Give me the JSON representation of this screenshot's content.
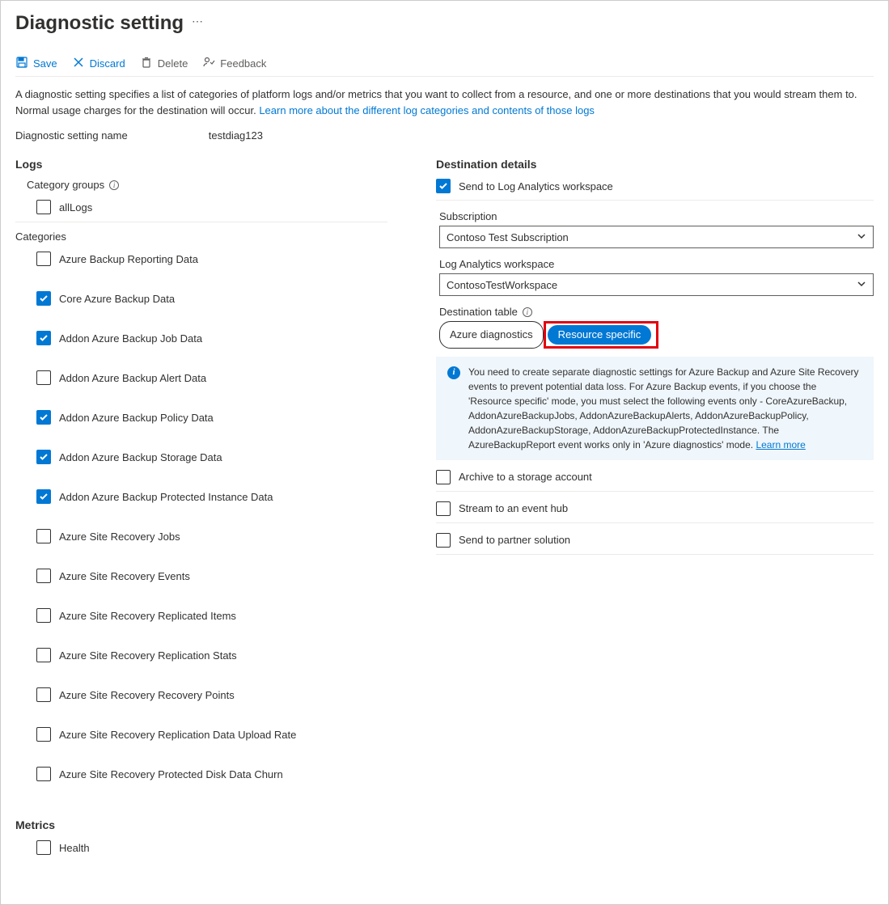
{
  "title": "Diagnostic setting",
  "toolbar": {
    "save": "Save",
    "discard": "Discard",
    "delete": "Delete",
    "feedback": "Feedback"
  },
  "intro": {
    "text": "A diagnostic setting specifies a list of categories of platform logs and/or metrics that you want to collect from a resource, and one or more destinations that you would stream them to. Normal usage charges for the destination will occur. ",
    "link": "Learn more about the different log categories and contents of those logs"
  },
  "name": {
    "label": "Diagnostic setting name",
    "value": "testdiag123"
  },
  "logs": {
    "heading": "Logs",
    "groups_heading": "Category groups",
    "groups": [
      {
        "label": "allLogs",
        "checked": false
      }
    ],
    "categories_heading": "Categories",
    "categories": [
      {
        "label": "Azure Backup Reporting Data",
        "checked": false
      },
      {
        "label": "Core Azure Backup Data",
        "checked": true
      },
      {
        "label": "Addon Azure Backup Job Data",
        "checked": true
      },
      {
        "label": "Addon Azure Backup Alert Data",
        "checked": false
      },
      {
        "label": "Addon Azure Backup Policy Data",
        "checked": true
      },
      {
        "label": "Addon Azure Backup Storage Data",
        "checked": true
      },
      {
        "label": "Addon Azure Backup Protected Instance Data",
        "checked": true
      },
      {
        "label": "Azure Site Recovery Jobs",
        "checked": false
      },
      {
        "label": "Azure Site Recovery Events",
        "checked": false
      },
      {
        "label": "Azure Site Recovery Replicated Items",
        "checked": false
      },
      {
        "label": "Azure Site Recovery Replication Stats",
        "checked": false
      },
      {
        "label": "Azure Site Recovery Recovery Points",
        "checked": false
      },
      {
        "label": "Azure Site Recovery Replication Data Upload Rate",
        "checked": false
      },
      {
        "label": "Azure Site Recovery Protected Disk Data Churn",
        "checked": false
      }
    ]
  },
  "metrics": {
    "heading": "Metrics",
    "items": [
      {
        "label": "Health",
        "checked": false
      }
    ]
  },
  "dest": {
    "heading": "Destination details",
    "la": {
      "label": "Send to Log Analytics workspace",
      "checked": true,
      "subscription_label": "Subscription",
      "subscription_value": "Contoso Test Subscription",
      "workspace_label": "Log Analytics workspace",
      "workspace_value": "ContosoTestWorkspace",
      "table_label": "Destination table",
      "pill_azure": "Azure diagnostics",
      "pill_resource": "Resource specific",
      "banner": "You need to create separate diagnostic settings for Azure Backup and Azure Site Recovery events to prevent potential data loss. For Azure Backup events, if you choose the 'Resource specific' mode, you must select the following events only - CoreAzureBackup, AddonAzureBackupJobs, AddonAzureBackupAlerts, AddonAzureBackupPolicy, AddonAzureBackupStorage, AddonAzureBackupProtectedInstance. The AzureBackupReport event works only in 'Azure diagnostics' mode.  ",
      "banner_link": "Learn more"
    },
    "storage": {
      "label": "Archive to a storage account",
      "checked": false
    },
    "eventhub": {
      "label": "Stream to an event hub",
      "checked": false
    },
    "partner": {
      "label": "Send to partner solution",
      "checked": false
    }
  }
}
